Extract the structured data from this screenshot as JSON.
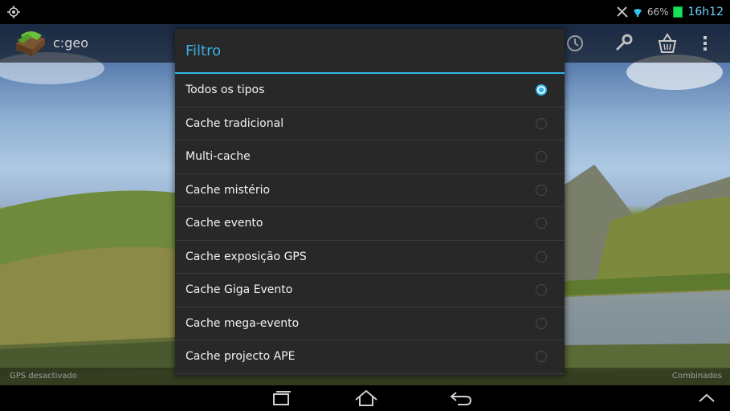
{
  "status_bar": {
    "battery_percent": "66%",
    "time": "16h12",
    "icons": [
      "location-icon",
      "signal-muted-icon",
      "wifi-icon",
      "battery-icon"
    ]
  },
  "action_bar": {
    "app_title": "c:geo",
    "icons": [
      "history-icon",
      "settings-wrench-icon",
      "basket-icon",
      "overflow-menu-icon"
    ]
  },
  "dialog": {
    "title": "Filtro",
    "accent": "#33b5e5",
    "selected_index": 0,
    "options": [
      {
        "label": "Todos os tipos"
      },
      {
        "label": "Cache tradicional"
      },
      {
        "label": "Multi-cache"
      },
      {
        "label": "Cache mistério"
      },
      {
        "label": "Cache evento"
      },
      {
        "label": "Cache exposição GPS"
      },
      {
        "label": "Cache Giga Evento"
      },
      {
        "label": "Cache mega-evento"
      },
      {
        "label": "Cache projecto APE"
      }
    ]
  },
  "info_bar": {
    "gps_status": "GPS desactivado",
    "map_source": "Combinados"
  },
  "nav_bar": {
    "icons": [
      "recent-apps-icon",
      "home-icon",
      "back-icon",
      "chevron-up-icon"
    ]
  }
}
